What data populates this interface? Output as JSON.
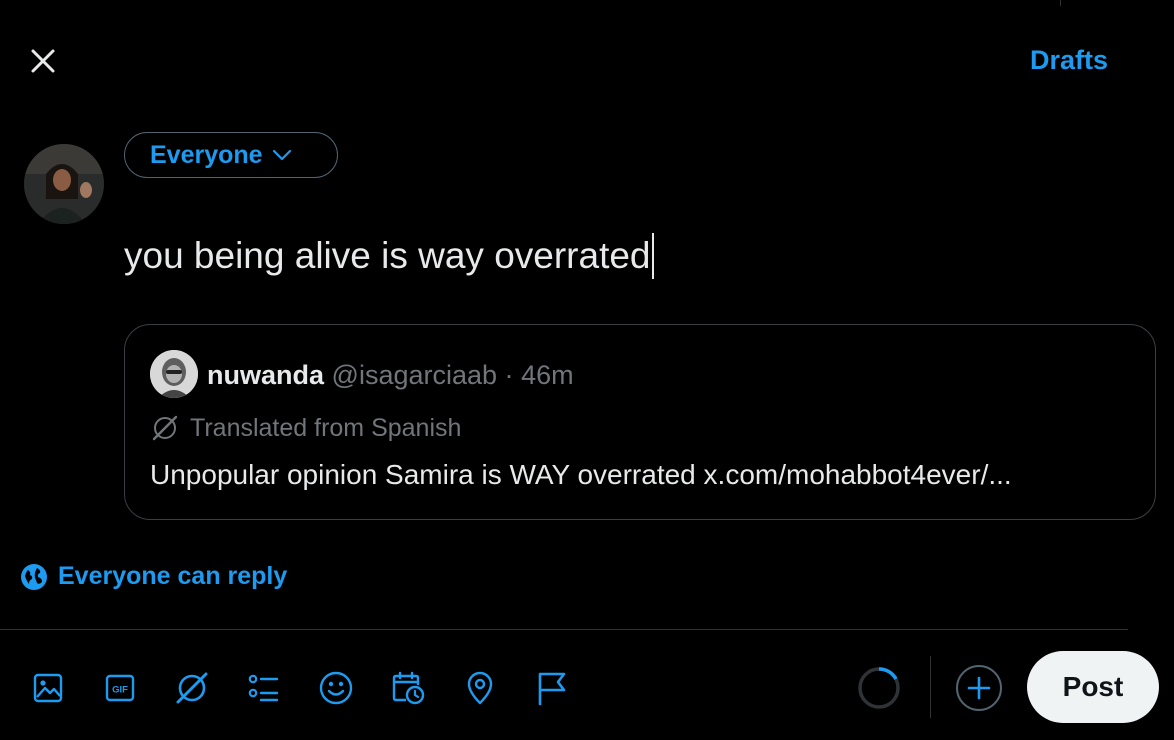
{
  "header": {
    "drafts_label": "Drafts"
  },
  "composer": {
    "audience_label": "Everyone",
    "text": "you being alive is way overrated"
  },
  "quote": {
    "name": "nuwanda",
    "handle": "@isagarciaab",
    "separator": "·",
    "time": "46m",
    "translated_label": "Translated from Spanish",
    "text": "Unpopular opinion Samira is WAY overrated x.com/mohabbot4ever/..."
  },
  "reply_setting": {
    "label": "Everyone can reply"
  },
  "toolbar": {
    "icons": [
      "image-icon",
      "gif-icon",
      "grok-icon",
      "poll-icon",
      "emoji-icon",
      "schedule-icon",
      "location-icon",
      "flag-icon"
    ],
    "post_label": "Post"
  },
  "colors": {
    "accent": "#1d9bf0",
    "background": "#000000",
    "text": "#e7e9ea",
    "muted": "#71767b",
    "border": "#2f3336"
  }
}
